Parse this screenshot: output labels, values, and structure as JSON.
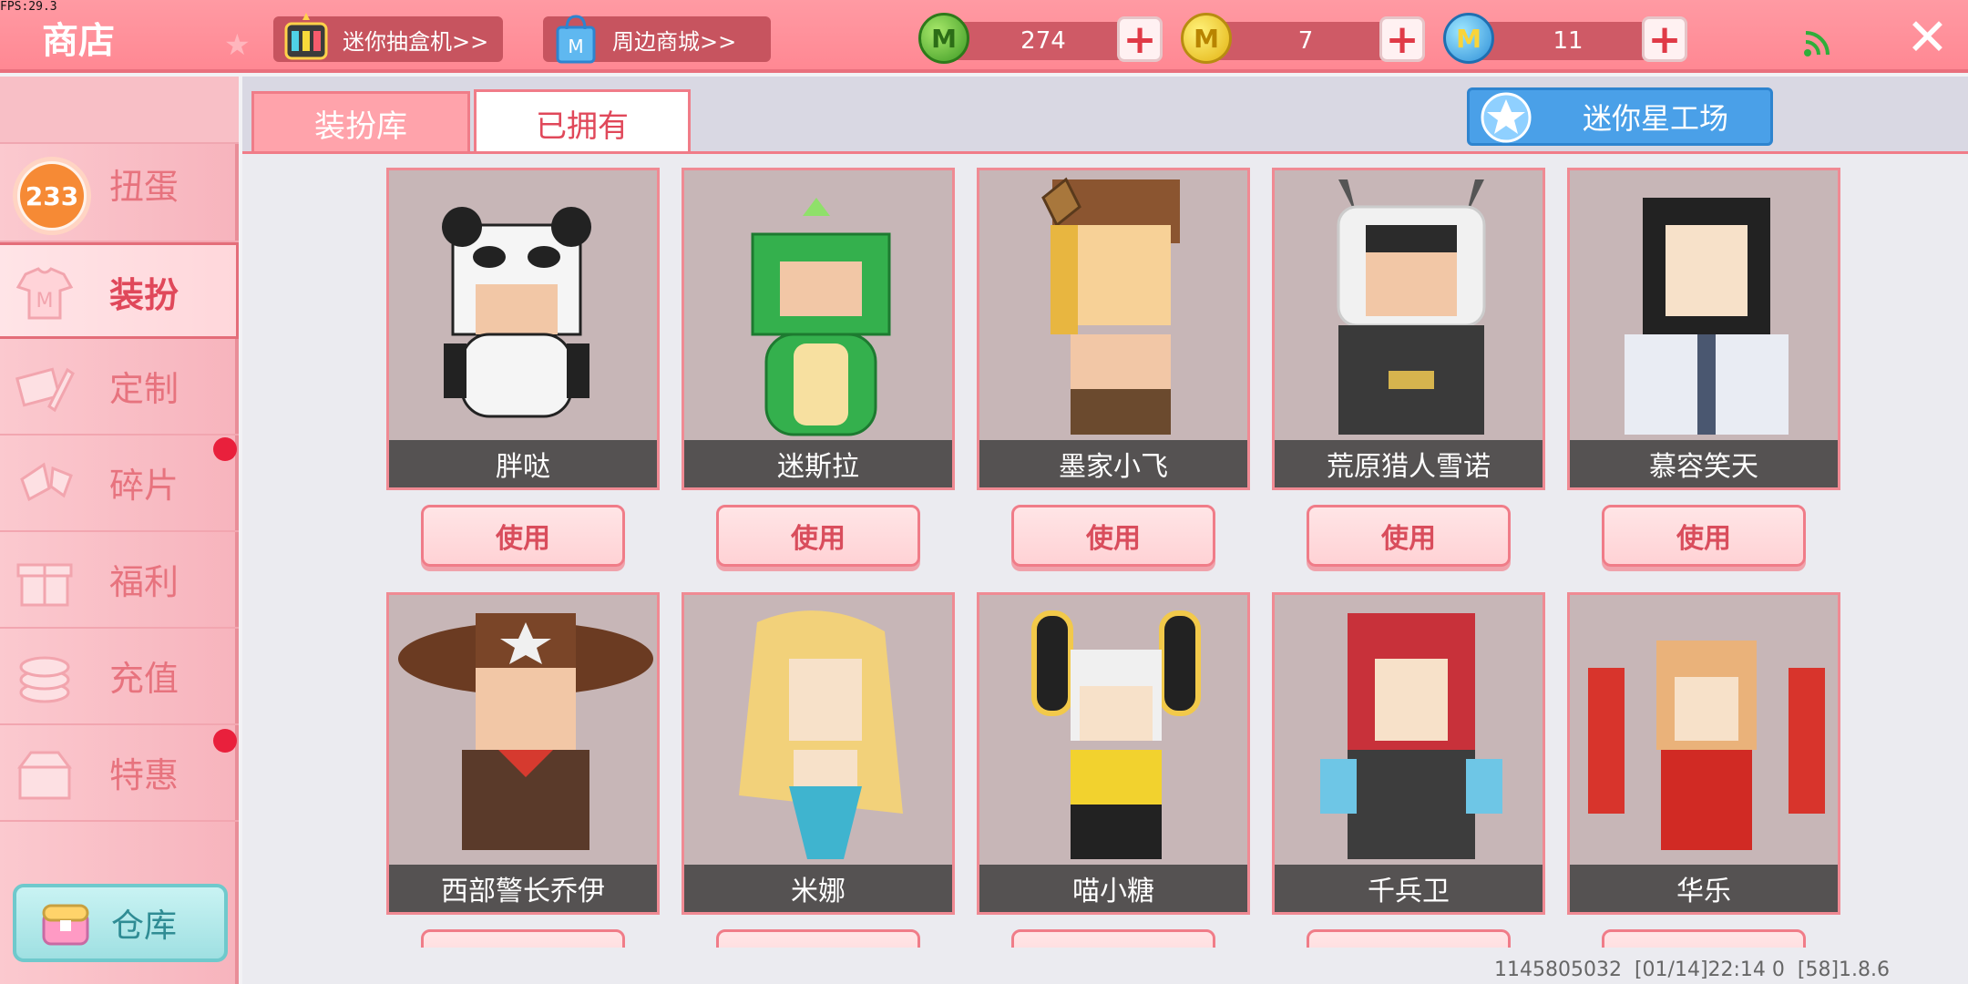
{
  "fps": "FPS:29.3",
  "shop_title": "商店",
  "top_buttons": {
    "gacha": "迷你抽盒机>>",
    "mall": "周边商城>>"
  },
  "currencies": [
    {
      "icon": "green-mini-bean-icon",
      "amount": "274"
    },
    {
      "icon": "gold-mini-coin-icon",
      "amount": "7"
    },
    {
      "icon": "blue-mini-coin-icon",
      "amount": "11"
    }
  ],
  "sidebar": {
    "gacha_badge": "233",
    "items": [
      {
        "label": "扭蛋"
      },
      {
        "label": "装扮"
      },
      {
        "label": "定制"
      },
      {
        "label": "碎片"
      },
      {
        "label": "福利"
      },
      {
        "label": "充值"
      },
      {
        "label": "特惠"
      }
    ],
    "warehouse": "仓库"
  },
  "tabs": [
    "装扮库",
    "已拥有"
  ],
  "workshop_label": "迷你星工场",
  "use_label": "使用",
  "skins": [
    {
      "name": "胖哒"
    },
    {
      "name": "迷斯拉"
    },
    {
      "name": "墨家小飞"
    },
    {
      "name": "荒原猎人雪诺"
    },
    {
      "name": "慕容笑天"
    },
    {
      "name": "西部警长乔伊"
    },
    {
      "name": "米娜"
    },
    {
      "name": "喵小糖"
    },
    {
      "name": "千兵卫"
    },
    {
      "name": "华乐"
    }
  ],
  "footer": "1145805032  [01/14]22:14 0  [58]1.8.6",
  "colors": {
    "topbar": "#ff8893",
    "accent": "#e0485a",
    "sidebar": "#f7b4bd",
    "workshop": "#4aa0e8",
    "badge": "#f68a35",
    "reddot": "#e9203c"
  }
}
